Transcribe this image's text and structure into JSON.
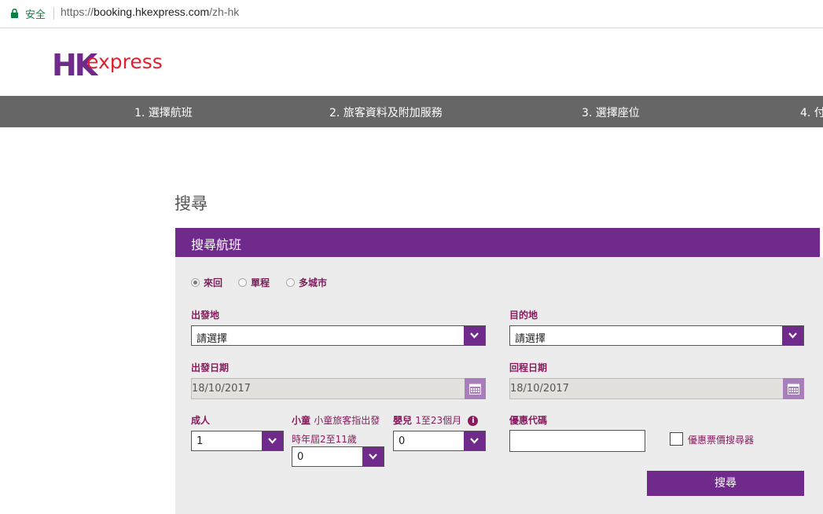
{
  "browser": {
    "secure_label": "安全",
    "url_scheme": "https://",
    "url_host": "booking.hkexpress.com",
    "url_path": "/zh-hk"
  },
  "logo": {
    "text_hk": "HK",
    "text_express": "express",
    "colors": {
      "purple": "#702a8c",
      "red": "#e2212e"
    }
  },
  "steps": [
    {
      "label": "1. 選擇航班"
    },
    {
      "label": "2. 旅客資料及附加服務"
    },
    {
      "label": "3. 選擇座位"
    },
    {
      "label": "4. 付"
    }
  ],
  "page": {
    "title": "搜尋"
  },
  "panel": {
    "header": "搜尋航班",
    "trip_types": [
      {
        "label": "來回",
        "selected": true
      },
      {
        "label": "單程",
        "selected": false
      },
      {
        "label": "多城市",
        "selected": false
      }
    ],
    "origin": {
      "label": "出發地",
      "value": "請選擇"
    },
    "destination": {
      "label": "目的地",
      "value": "請選擇"
    },
    "depart_date": {
      "label": "出發日期",
      "value": "18/10/2017"
    },
    "return_date": {
      "label": "回程日期",
      "value": "18/10/2017"
    },
    "adults": {
      "label": "成人",
      "value": "1"
    },
    "children": {
      "label": "小童",
      "note_line1": "小童旅客指出發",
      "note_line2": "時年屆2至11歲",
      "value": "0"
    },
    "infants": {
      "label": "嬰兒",
      "note": "1至23個月",
      "info_icon": "i",
      "value": "0"
    },
    "promo": {
      "label": "優惠代碼",
      "value": ""
    },
    "fare_finder": {
      "label": "優惠票價搜尋器",
      "checked": false
    },
    "search_button": "搜尋"
  },
  "colors": {
    "accent": "#702a8c",
    "step_bar": "#666666",
    "label": "#8a1a5e",
    "panel_bg": "#ececec"
  }
}
